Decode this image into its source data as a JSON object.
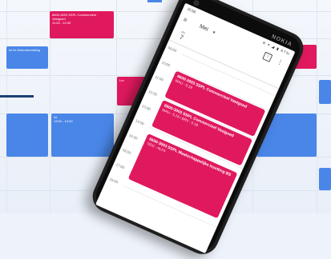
{
  "desktop_calendar": {
    "events": [
      {
        "title": "6600-3003 SSPL Commercieel",
        "subtitle": "Vastgoed",
        "time": "11:00 - 12:30"
      },
      {
        "title": "Ict ht Gebeurtenisking",
        "time": ""
      },
      {
        "title": "Ict",
        "time": "13:00 - 13:30"
      },
      {
        "title": "Lm",
        "time": ""
      }
    ]
  },
  "phone": {
    "brand": "NOKIA",
    "status_bar": {
      "time": "15:58",
      "icons": "⊖ ▾ ◢ ▮ 67%"
    },
    "app_bar": {
      "month": "Mei",
      "caret": "▾",
      "menu_icon": "≡",
      "more_icon": "⋮",
      "calendar_icon_text": "7"
    },
    "day": {
      "name": "do.",
      "number": "7"
    },
    "hours": [
      "09:00",
      "10:00",
      "11:00",
      "12:00",
      "13:00",
      "14:00",
      "15:00",
      "16:00",
      "17:00",
      "18:00"
    ],
    "events": [
      {
        "title": "6600-3003 SSPL Commercieel Vastgoed",
        "detail": "MAU - 5.19"
      },
      {
        "title": "6600-3003 SSPL Commercieel Vastgoed",
        "detail": "MAU - 5.19 / BRV - 5.19"
      },
      {
        "title": "6600-3003 SSPL Maatschappelijke Inzetting BS",
        "detail": "ODC - ALFA"
      }
    ]
  }
}
